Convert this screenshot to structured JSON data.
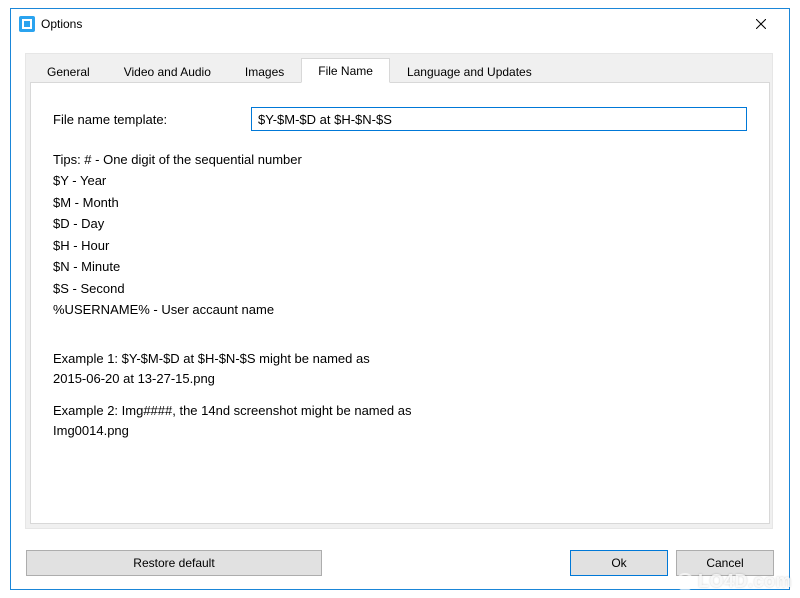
{
  "window": {
    "title": "Options"
  },
  "tabs": {
    "general": "General",
    "video_audio": "Video and Audio",
    "images": "Images",
    "file_name": "File Name",
    "lang_updates": "Language and Updates"
  },
  "form": {
    "template_label": "File name template:",
    "template_value": "$Y-$M-$D at $H-$N-$S"
  },
  "tips": {
    "line0": "Tips: # - One digit of the sequential number",
    "line1": "$Y - Year",
    "line2": "$M - Month",
    "line3": "$D - Day",
    "line4": "$H - Hour",
    "line5": "$N - Minute",
    "line6": "$S - Second",
    "line7": "%USERNAME% - User accaunt name"
  },
  "examples": {
    "ex1_line1": "Example 1: $Y-$M-$D at $H-$N-$S might be named as",
    "ex1_line2": "2015-06-20 at 13-27-15.png",
    "ex2_line1": "Example 2: Img####, the 14nd screenshot might be named as",
    "ex2_line2": "Img0014.png"
  },
  "buttons": {
    "restore": "Restore default",
    "ok": "Ok",
    "cancel": "Cancel"
  },
  "watermark": "LO4D.com"
}
